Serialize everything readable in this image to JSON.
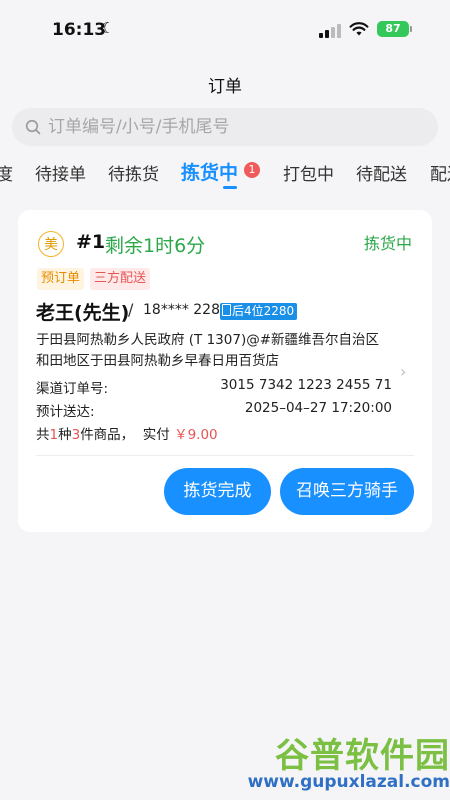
{
  "status_bar": {
    "time": "16:13",
    "battery": "87"
  },
  "header": {
    "title": "订单"
  },
  "search": {
    "placeholder": "订单编号/小号/手机尾号"
  },
  "tabs": [
    {
      "label": "度"
    },
    {
      "label": "待接单"
    },
    {
      "label": "待拣货"
    },
    {
      "label": "拣货中",
      "badge": "1"
    },
    {
      "label": "打包中"
    },
    {
      "label": "待配送"
    },
    {
      "label": "配送"
    }
  ],
  "order": {
    "platform_badge": "美",
    "number": "#1",
    "remaining": "剩余1时6分",
    "status": "拣货中",
    "tags": [
      "预订单",
      "三方配送"
    ],
    "customer_name": "老王(先生)",
    "separator": "/",
    "phone": "18**** 2280",
    "phone_suffix_label": "后4位2280",
    "address": "于田县阿热勒乡人民政府 (T 1307)@#新疆维吾尔自治区和田地区于田县阿热勒乡早春日用百货店",
    "channel_order_label": "渠道订单号:",
    "channel_order_value": "3015 7342 1223 2455 71",
    "eta_label": "预计送达:",
    "eta_value": "2025–04–27 17:20:00",
    "summary": {
      "prefix": "共",
      "kinds": "1",
      "kinds_unit": "种",
      "count": "3",
      "count_unit": "件商品，",
      "paid_label": "实付",
      "paid_value": "￥9.00"
    },
    "actions": {
      "pick_done": "拣货完成",
      "call_rider": "召唤三方骑手"
    }
  },
  "watermark": {
    "title": "谷普软件园",
    "url": "www.gupuxlazal.com"
  },
  "colors": {
    "accent": "#1890ff",
    "success": "#2ca84a",
    "danger": "#e85555",
    "warning": "#e88b00"
  }
}
